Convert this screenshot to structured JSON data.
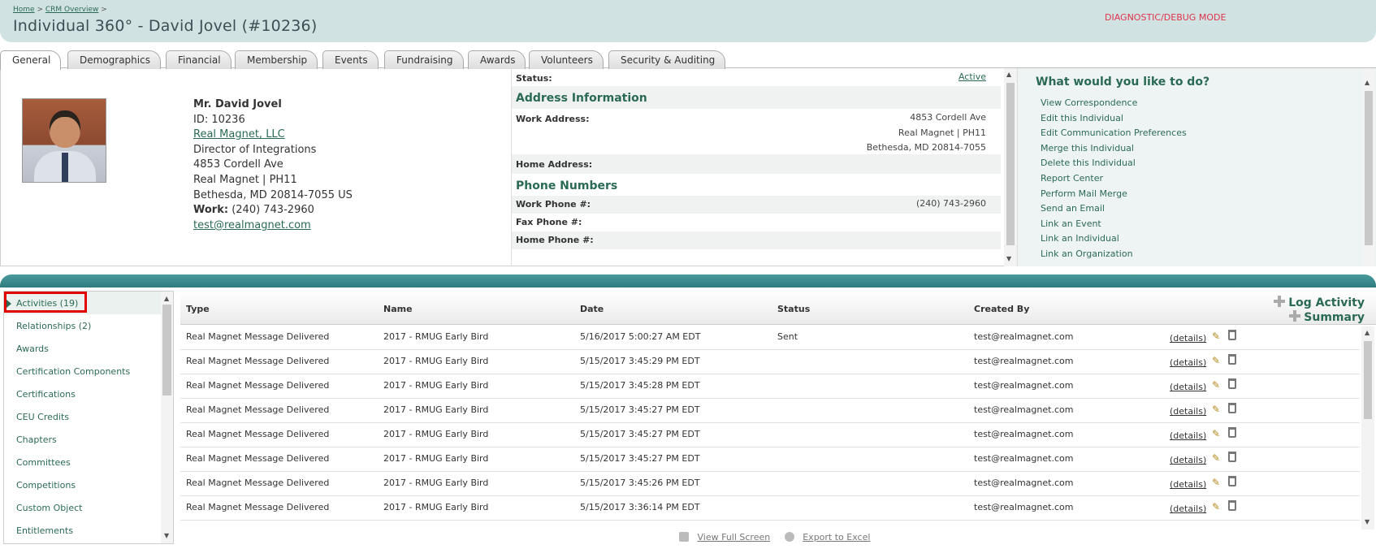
{
  "header": {
    "breadcrumb": {
      "home": "Home",
      "sep1": ">",
      "crm": "CRM Overview",
      "sep2": ">"
    },
    "title": "Individual 360° - David Jovel (#10236)",
    "debug": "DIAGNOSTIC/DEBUG MODE"
  },
  "tabs": [
    "General",
    "Demographics",
    "Financial",
    "Membership",
    "Events",
    "Fundraising",
    "Awards",
    "Volunteers",
    "Security & Auditing"
  ],
  "contact": {
    "name": "Mr. David Jovel",
    "id": "ID: 10236",
    "company": "Real Magnet, LLC",
    "job_title": "Director of Integrations",
    "address1": "4853 Cordell Ave",
    "address2": "Real Magnet | PH11",
    "city": "Bethesda, MD 20814-7055 US",
    "work_label": "Work:",
    "work_phone": "(240) 743-2960",
    "email": "test@realmagnet.com"
  },
  "details": {
    "status_label": "Status:",
    "status_value": "Active",
    "address_section": "Address Information",
    "work_address_label": "Work Address:",
    "work_address": [
      "4853 Cordell Ave",
      "Real Magnet | PH11",
      "Bethesda, MD 20814-7055"
    ],
    "home_address_label": "Home Address:",
    "phone_section": "Phone Numbers",
    "work_phone_label": "Work Phone #:",
    "work_phone_value": "(240) 743-2960",
    "fax_phone_label": "Fax Phone #:",
    "home_phone_label": "Home Phone #:"
  },
  "actions": {
    "title": "What would you like to do?",
    "items": [
      "View Correspondence",
      "Edit this Individual",
      "Edit Communication Preferences",
      "Merge this Individual",
      "Delete this Individual",
      "Report Center",
      "Perform Mail Merge",
      "Send an Email",
      "Link an Event",
      "Link an Individual",
      "Link an Organization"
    ]
  },
  "leftnav": {
    "items": [
      "Activities (19)",
      "Relationships (2)",
      "Awards",
      "Certification Components",
      "Certifications",
      "CEU Credits",
      "Chapters",
      "Committees",
      "Competitions",
      "Custom Object",
      "Entitlements"
    ]
  },
  "grid": {
    "columns": {
      "type": "Type",
      "name": "Name",
      "date": "Date",
      "status": "Status",
      "created_by": "Created By"
    },
    "log_activity": "Log Activity",
    "summary": "Summary",
    "details_label": "(details)",
    "rows": [
      {
        "type": "Real Magnet Message Delivered",
        "name": "2017 - RMUG Early Bird",
        "date": "5/16/2017 5:00:27 AM EDT",
        "status": "Sent",
        "created_by": "test@realmagnet.com"
      },
      {
        "type": "Real Magnet Message Delivered",
        "name": "2017 - RMUG Early Bird",
        "date": "5/15/2017 3:45:29 PM EDT",
        "status": "",
        "created_by": "test@realmagnet.com"
      },
      {
        "type": "Real Magnet Message Delivered",
        "name": "2017 - RMUG Early Bird",
        "date": "5/15/2017 3:45:28 PM EDT",
        "status": "",
        "created_by": "test@realmagnet.com"
      },
      {
        "type": "Real Magnet Message Delivered",
        "name": "2017 - RMUG Early Bird",
        "date": "5/15/2017 3:45:27 PM EDT",
        "status": "",
        "created_by": "test@realmagnet.com"
      },
      {
        "type": "Real Magnet Message Delivered",
        "name": "2017 - RMUG Early Bird",
        "date": "5/15/2017 3:45:27 PM EDT",
        "status": "",
        "created_by": "test@realmagnet.com"
      },
      {
        "type": "Real Magnet Message Delivered",
        "name": "2017 - RMUG Early Bird",
        "date": "5/15/2017 3:45:27 PM EDT",
        "status": "",
        "created_by": "test@realmagnet.com"
      },
      {
        "type": "Real Magnet Message Delivered",
        "name": "2017 - RMUG Early Bird",
        "date": "5/15/2017 3:45:26 PM EDT",
        "status": "",
        "created_by": "test@realmagnet.com"
      },
      {
        "type": "Real Magnet Message Delivered",
        "name": "2017 - RMUG Early Bird",
        "date": "5/15/2017 3:36:14 PM EDT",
        "status": "",
        "created_by": "test@realmagnet.com"
      }
    ]
  },
  "footer": {
    "full_screen": "View Full Screen",
    "export": "Export to Excel"
  }
}
